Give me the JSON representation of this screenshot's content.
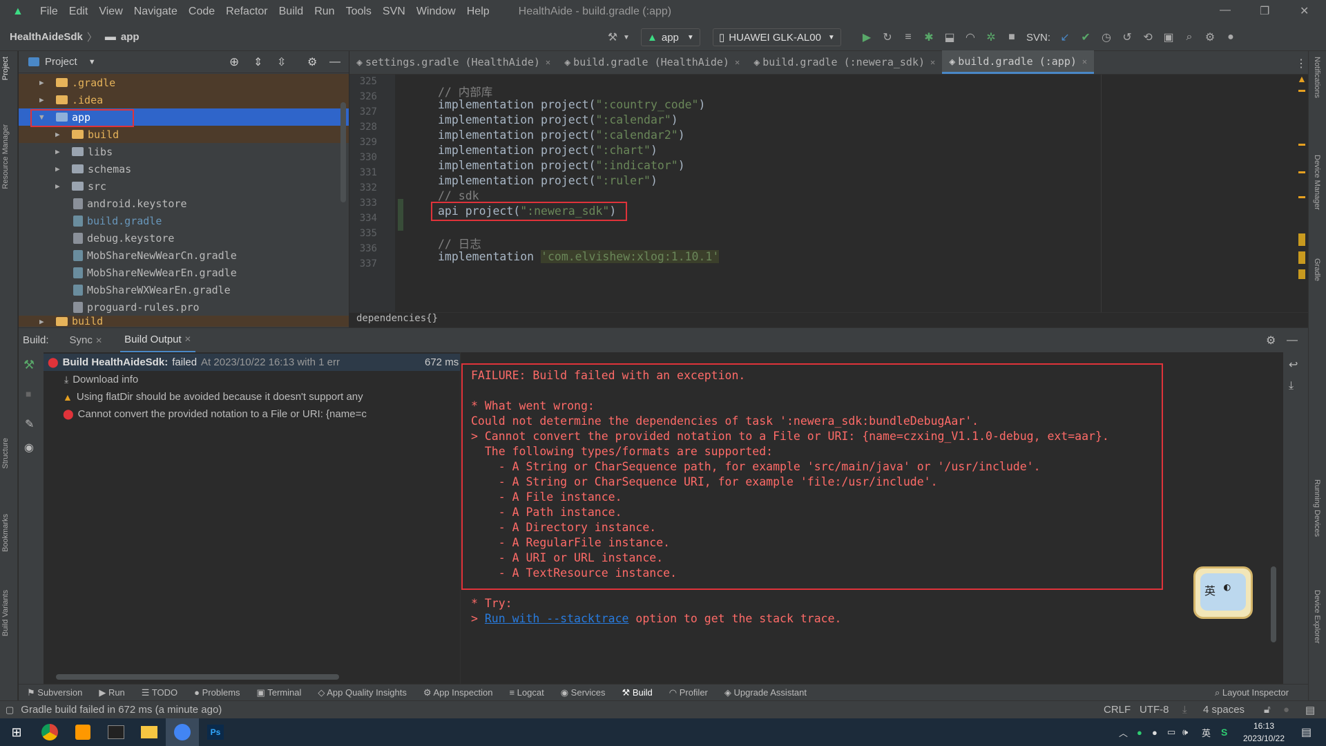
{
  "window": {
    "title": "HealthAide - build.gradle (:app)"
  },
  "menu": [
    "File",
    "Edit",
    "View",
    "Navigate",
    "Code",
    "Refactor",
    "Build",
    "Run",
    "Tools",
    "SVN",
    "Window",
    "Help"
  ],
  "breadcrumb": {
    "project": "HealthAideSdk",
    "module": "app"
  },
  "toolbar": {
    "run_config": "app",
    "device": "HUAWEI GLK-AL00",
    "svn_label": "SVN:"
  },
  "project_panel": {
    "title": "Project",
    "tree": [
      {
        "label": ".gradle",
        "color": "#e6b35a"
      },
      {
        "label": ".idea",
        "color": "#e6b35a"
      },
      {
        "label": "app",
        "color": "#ffffff"
      },
      {
        "label": "build",
        "color": "#e6b35a"
      },
      {
        "label": "libs",
        "color": "#bbbbbb"
      },
      {
        "label": "schemas",
        "color": "#bbbbbb"
      },
      {
        "label": "src",
        "color": "#bbbbbb"
      },
      {
        "label": "android.keystore",
        "color": "#bbbbbb"
      },
      {
        "label": "build.gradle",
        "color": "#6897bb"
      },
      {
        "label": "debug.keystore",
        "color": "#bbbbbb"
      },
      {
        "label": "MobShareNewWearCn.gradle",
        "color": "#bbbbbb"
      },
      {
        "label": "MobShareNewWearEn.gradle",
        "color": "#bbbbbb"
      },
      {
        "label": "MobShareWXWearEn.gradle",
        "color": "#bbbbbb"
      },
      {
        "label": "proguard-rules.pro",
        "color": "#bbbbbb"
      },
      {
        "label": "build",
        "color": "#e6b35a"
      }
    ]
  },
  "editor": {
    "tabs": [
      "settings.gradle (HealthAide)",
      "build.gradle (HealthAide)",
      "build.gradle (:newera_sdk)",
      "build.gradle (:app)"
    ],
    "line_numbers": [
      "325",
      "326",
      "327",
      "328",
      "329",
      "330",
      "331",
      "332",
      "333",
      "334",
      "335",
      "336",
      "337"
    ],
    "code": {
      "l326": "// 内部库",
      "l327a": "implementation project(",
      "l327b": "\":country_code\"",
      "l327c": ")",
      "l328a": "implementation project(",
      "l328b": "\":calendar\"",
      "l328c": ")",
      "l329a": "implementation project(",
      "l329b": "\":calendar2\"",
      "l329c": ")",
      "l330a": "implementation project(",
      "l330b": "\":chart\"",
      "l330c": ")",
      "l331a": "implementation project(",
      "l331b": "\":indicator\"",
      "l331c": ")",
      "l332a": "implementation project(",
      "l332b": "\":ruler\"",
      "l332c": ")",
      "l333": "// sdk",
      "l334a": "api project(",
      "l334b": "\":newera_sdk\"",
      "l334c": ")",
      "l336": "// 日志",
      "l337a": "implementation ",
      "l337b": "'com.elvishew:xlog:1.10.1'"
    },
    "crumb": "dependencies{}"
  },
  "build_panel": {
    "label": "Build:",
    "tabs": [
      "Sync",
      "Build Output"
    ],
    "tree": {
      "root_title": "Build HealthAideSdk:",
      "root_status": "failed",
      "root_time": "At 2023/10/22 16:13 with 1 err",
      "root_ms": "672 ms",
      "item1": "Download info",
      "item2": "Using flatDir should be avoided because it doesn't support any",
      "item3": "Cannot convert the provided notation to a File or URI: {name=c"
    },
    "output": [
      "FAILURE: Build failed with an exception.",
      "",
      "* What went wrong:",
      "Could not determine the dependencies of task ':newera_sdk:bundleDebugAar'.",
      "> Cannot convert the provided notation to a File or URI: {name=czxing_V1.1.0-debug, ext=aar}.",
      "  The following types/formats are supported:",
      "    - A String or CharSequence path, for example 'src/main/java' or '/usr/include'.",
      "    - A String or CharSequence URI, for example 'file:/usr/include'.",
      "    - A File instance.",
      "    - A Path instance.",
      "    - A Directory instance.",
      "    - A RegularFile instance.",
      "    - A URI or URL instance.",
      "    - A TextResource instance.",
      "",
      "* Try:"
    ],
    "try_prefix": "> ",
    "try_link": "Run with --stacktrace",
    "try_suffix": " option to get the stack trace."
  },
  "bottom_tabs": [
    "Subversion",
    "Run",
    "TODO",
    "Problems",
    "Terminal",
    "App Quality Insights",
    "App Inspection",
    "Logcat",
    "Services",
    "Build",
    "Profiler",
    "Upgrade Assistant"
  ],
  "layout_inspector": "Layout Inspector",
  "side_tabs": {
    "left": [
      "Project",
      "Resource Manager",
      "Structure",
      "Bookmarks",
      "Build Variants"
    ],
    "right": [
      "Notifications",
      "Device Manager",
      "Gradle",
      "Running Devices",
      "Device Explorer"
    ]
  },
  "statusbar": {
    "message": "Gradle build failed in 672 ms (a minute ago)",
    "crlf": "CRLF",
    "encoding": "UTF-8",
    "indent": "4 spaces"
  },
  "taskbar": {
    "time": "16:13",
    "date": "2023/10/22",
    "ime": "英"
  },
  "ime_widget": "英"
}
